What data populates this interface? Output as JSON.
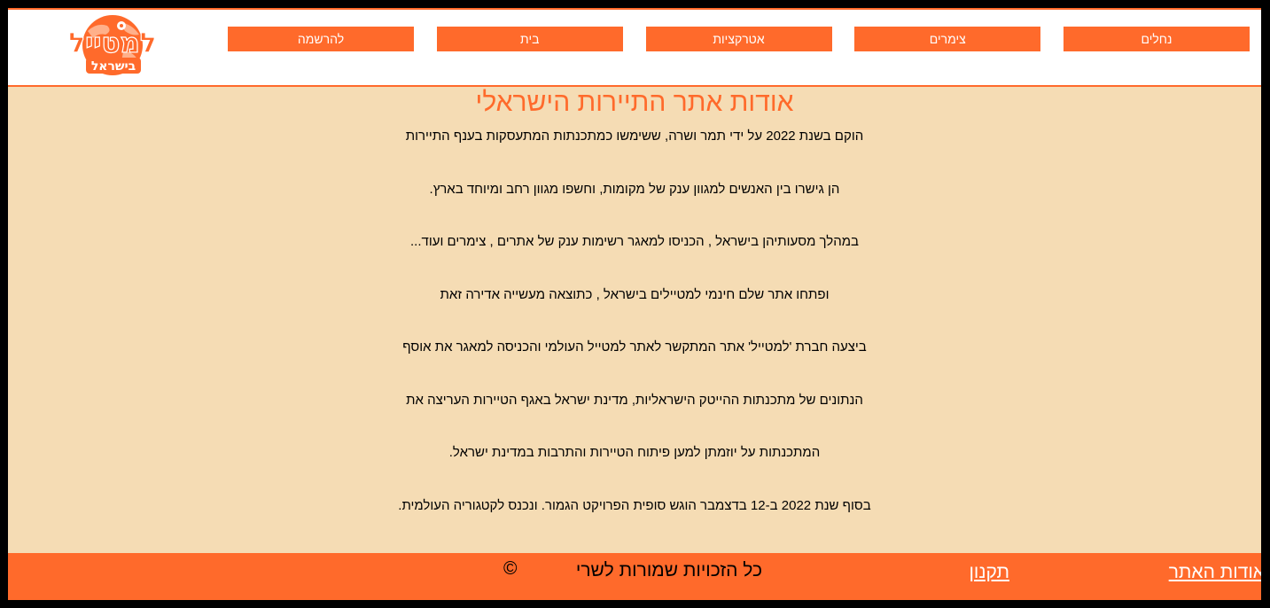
{
  "logo": {
    "text_main": "למטייל",
    "text_sub": "בישראל",
    "color": "#ff6a2b"
  },
  "nav": {
    "items": [
      {
        "label": "נחלים"
      },
      {
        "label": "צימרים"
      },
      {
        "label": "אטרקציות"
      },
      {
        "label": "בית"
      },
      {
        "label": "להרשמה"
      }
    ],
    "color": "#ff6a2b"
  },
  "main": {
    "title": "אודות אתר התיירות הישראלי",
    "paragraphs": [
      "הוקם בשנת 2022 על ידי תמר ושרה, ששימשו כמתכנתות המתעסקות בענף התיירות",
      "הן גישרו בין האנשים למגוון ענק של מקומות, וחשפו מגוון רחב ומיוחד בארץ.",
      "במהלך מסעותיהן בישראל , הכניסו למאגר רשימות ענק של אתרים , צימרים ועוד...",
      "ופתחו אתר שלם חינמי למטיילים בישראל , כתוצאה מעשייה אדירה זאת",
      "ביצעה חברת 'למטייל' אתר המתקשר לאתר למטייל העולמי והכניסה למאגר את אוסף",
      "הנתונים של מתכנתות ההייטק הישראליות,  מדינת ישראל באגף הטיירות העריצה את",
      "המתכנתות על יוזמתן למען פיתוח הטיירות והתרבות במדינת ישראל.",
      "בסוף שנת 2022 ב-12 בדצמבר הוגש סופית הפרויקט הגמור. ונכנס לקטגוריה העולמית."
    ],
    "background": "#f5dcb4"
  },
  "footer": {
    "about_label": "אודות האתר",
    "terms_label": "תקנון",
    "copyright_text": "כל הזכויות שמורות לשרי",
    "copyright_symbol": "©",
    "background": "#ff6a2b"
  }
}
